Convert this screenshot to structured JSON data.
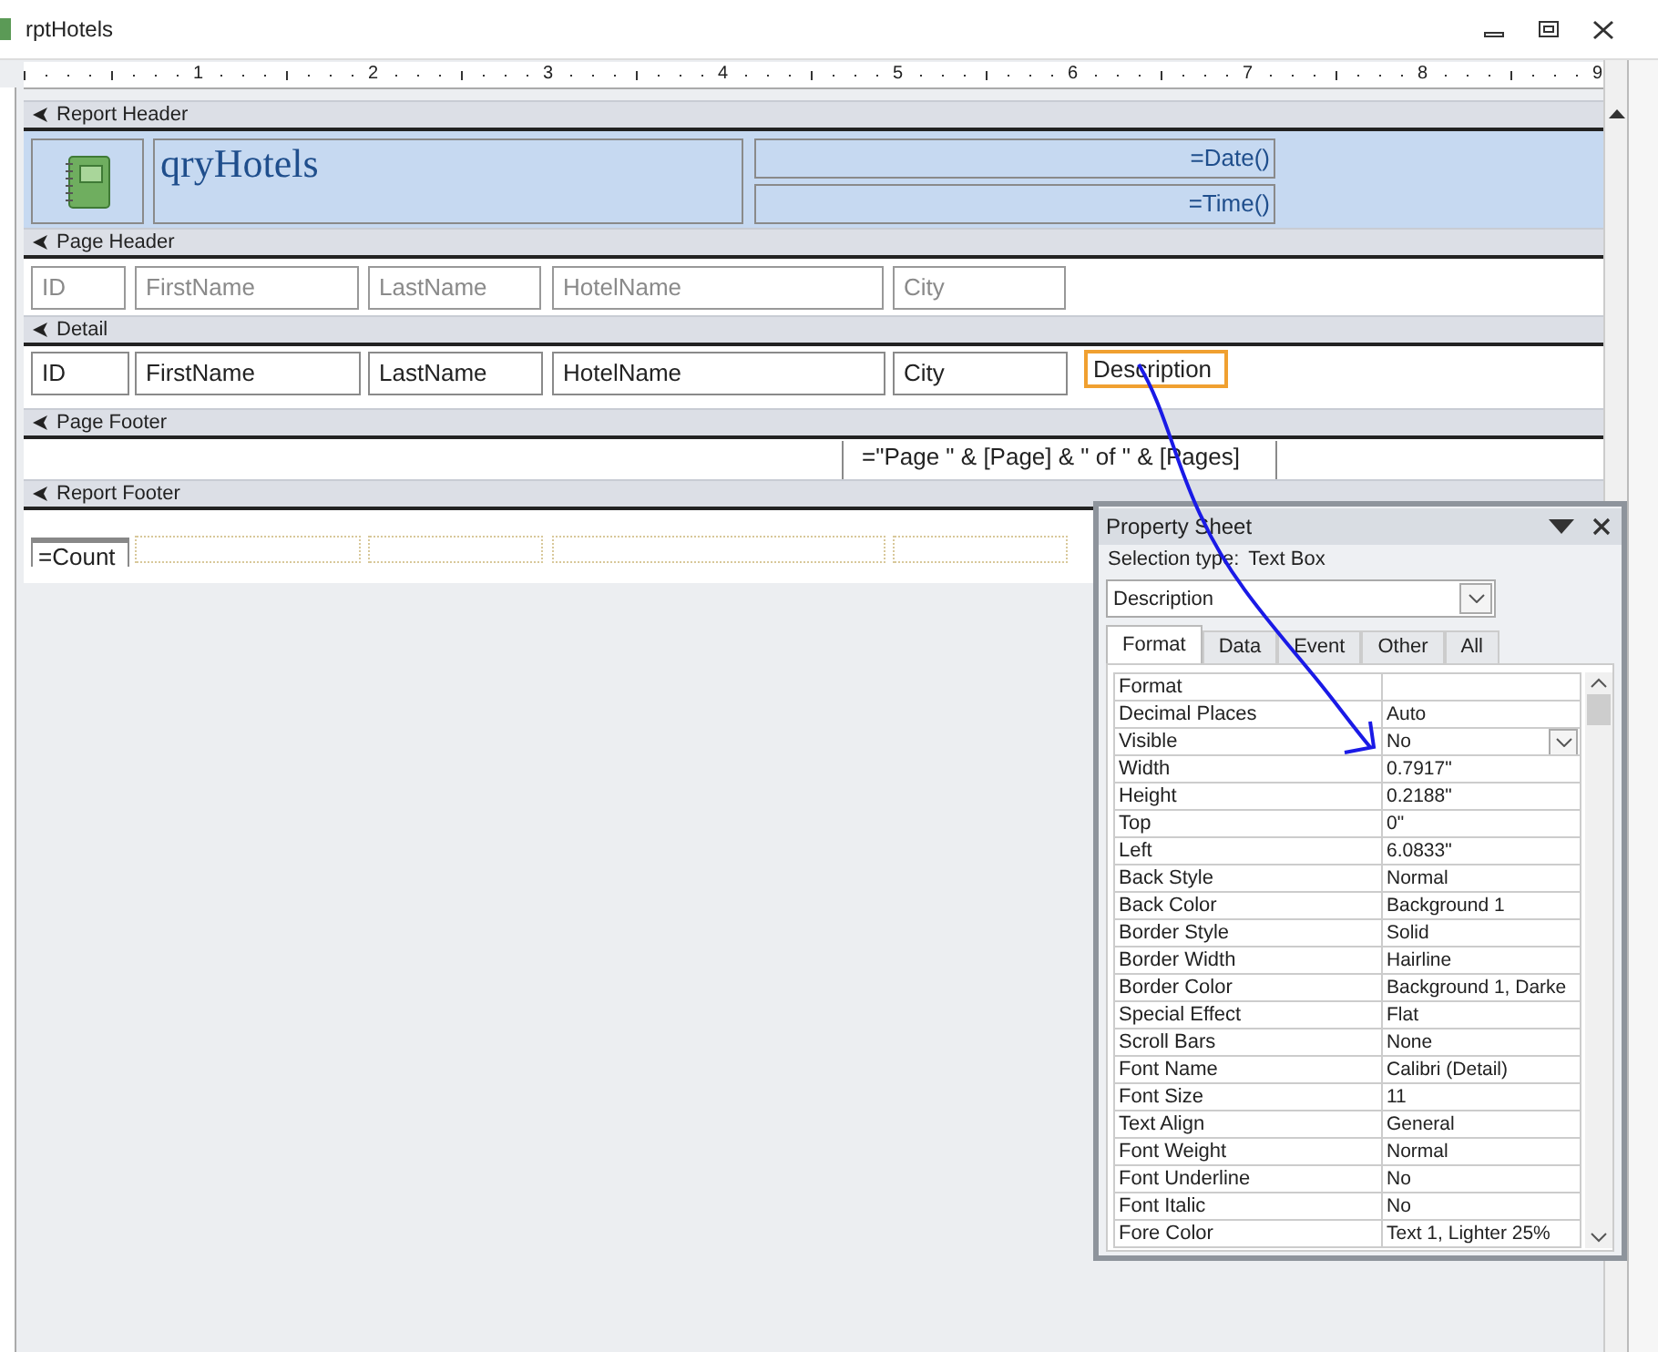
{
  "window": {
    "title": "rptHotels"
  },
  "ruler": {
    "marks": [
      "1",
      "2",
      "3",
      "4",
      "5",
      "6",
      "7",
      "8",
      "9"
    ]
  },
  "sections": [
    {
      "title": "Report Header",
      "kind": "report_header",
      "controls": [
        {
          "kind": "logo"
        },
        {
          "kind": "title",
          "text": "qryHotels"
        },
        {
          "kind": "textbox",
          "text": "=Date()",
          "selected": false
        },
        {
          "kind": "textbox",
          "text": "=Time()",
          "selected": false
        }
      ]
    },
    {
      "title": "Page Header",
      "kind": "page_header",
      "controls": [
        {
          "kind": "label",
          "text": "ID"
        },
        {
          "kind": "label",
          "text": "FirstName"
        },
        {
          "kind": "label",
          "text": "LastName"
        },
        {
          "kind": "label",
          "text": "HotelName"
        },
        {
          "kind": "label",
          "text": "City"
        }
      ]
    },
    {
      "title": "Detail",
      "kind": "detail",
      "controls": [
        {
          "kind": "textbox",
          "text": "ID",
          "selected": false
        },
        {
          "kind": "textbox",
          "text": "FirstName",
          "selected": false
        },
        {
          "kind": "textbox",
          "text": "LastName",
          "selected": false
        },
        {
          "kind": "textbox",
          "text": "HotelName",
          "selected": false
        },
        {
          "kind": "textbox",
          "text": "City",
          "selected": false
        },
        {
          "kind": "textbox",
          "text": "Description",
          "selected": true
        }
      ]
    },
    {
      "title": "Page Footer",
      "kind": "page_footer",
      "controls": [
        {
          "kind": "textbox",
          "text": "=\"Page \" & [Page] & \" of \" & [Pages]",
          "selected": false
        }
      ]
    },
    {
      "title": "Report Footer",
      "kind": "report_footer",
      "controls": [
        {
          "kind": "textbox",
          "text": "=Count",
          "selected": false
        }
      ]
    }
  ],
  "property_sheet": {
    "title": "Property Sheet",
    "selection_label": "Selection type:",
    "selection_type": "Text Box",
    "object": "Description",
    "tabs": [
      {
        "label": "Format",
        "selected": true
      },
      {
        "label": "Data",
        "selected": false
      },
      {
        "label": "Event",
        "selected": false
      },
      {
        "label": "Other",
        "selected": false
      },
      {
        "label": "All",
        "selected": false
      }
    ],
    "properties": [
      {
        "name": "Format",
        "selected": false
      },
      {
        "name": "Decimal Places",
        "value": "Auto",
        "selected": false
      },
      {
        "name": "Visible",
        "value": "No",
        "selected": true
      },
      {
        "name": "Width",
        "value": "0.7917\"",
        "selected": false
      },
      {
        "name": "Height",
        "value": "0.2188\"",
        "selected": false
      },
      {
        "name": "Top",
        "value": "0\"",
        "selected": false
      },
      {
        "name": "Left",
        "value": "6.0833\"",
        "selected": false
      },
      {
        "name": "Back Style",
        "value": "Normal",
        "selected": false
      },
      {
        "name": "Back Color",
        "value": "Background 1",
        "selected": false
      },
      {
        "name": "Border Style",
        "value": "Solid",
        "selected": false
      },
      {
        "name": "Border Width",
        "value": "Hairline",
        "selected": false
      },
      {
        "name": "Border Color",
        "value": "Background 1, Darke",
        "selected": false
      },
      {
        "name": "Special Effect",
        "value": "Flat",
        "selected": false
      },
      {
        "name": "Scroll Bars",
        "value": "None",
        "selected": false
      },
      {
        "name": "Font Name",
        "value": "Calibri (Detail)",
        "selected": false
      },
      {
        "name": "Font Size",
        "value": "11",
        "selected": false
      },
      {
        "name": "Text Align",
        "value": "General",
        "selected": false
      },
      {
        "name": "Font Weight",
        "value": "Normal",
        "selected": false
      },
      {
        "name": "Font Underline",
        "value": "No",
        "selected": false
      },
      {
        "name": "Font Italic",
        "value": "No",
        "selected": false
      },
      {
        "name": "Fore Color",
        "value": "Text 1, Lighter 25%",
        "selected": false
      }
    ]
  }
}
